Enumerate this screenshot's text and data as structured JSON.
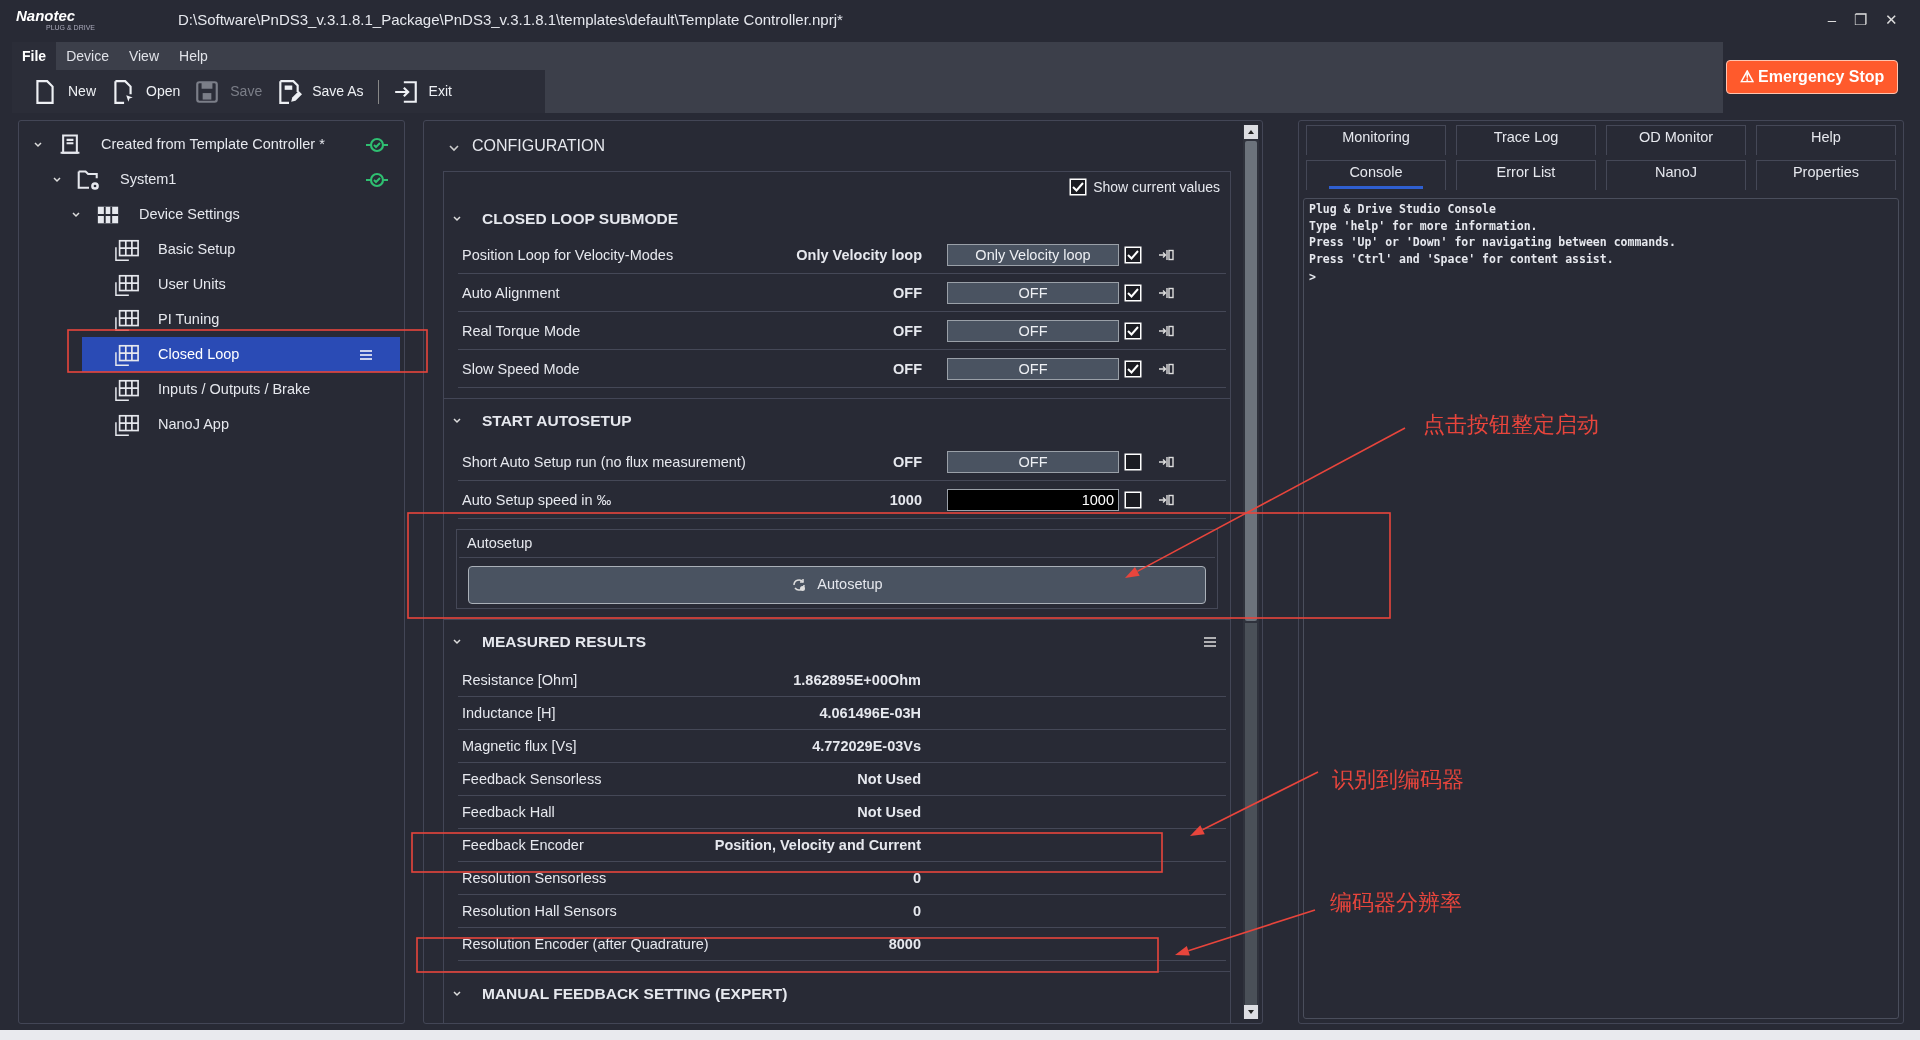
{
  "window": {
    "logo": "Nanotec",
    "logo_tagline": "PLUG & DRIVE",
    "title": "D:\\Software\\PnDS3_v.3.1.8.1_Package\\PnDS3_v.3.1.8.1\\templates\\default\\Template Controller.nprj*",
    "controls": [
      "–",
      "❐",
      "✕"
    ]
  },
  "menu": [
    {
      "label": "File",
      "selected": true
    },
    {
      "label": "Device",
      "selected": false
    },
    {
      "label": "View",
      "selected": false
    },
    {
      "label": "Help",
      "selected": false
    }
  ],
  "toolbar": [
    {
      "kind": "new",
      "label": "New",
      "disabled": false
    },
    {
      "kind": "open",
      "label": "Open",
      "disabled": false
    },
    {
      "kind": "save",
      "label": "Save",
      "disabled": true
    },
    {
      "kind": "saveas",
      "label": "Save As",
      "disabled": false
    },
    {
      "kind": "exit",
      "label": "Exit",
      "disabled": false
    }
  ],
  "emergency_stop": {
    "icon": "⚠",
    "label": "Emergency Stop"
  },
  "tree": [
    {
      "kind": "project",
      "label": "Created from Template Controller *",
      "expanded": true,
      "connected": true,
      "selected": false,
      "children": [
        {
          "kind": "system",
          "label": "System1",
          "expanded": true,
          "connected": true,
          "selected": false,
          "children": [
            {
              "kind": "settings",
              "label": "Device Settings",
              "expanded": true,
              "selected": false,
              "children": [
                {
                  "kind": "page",
                  "label": "Basic Setup",
                  "selected": false
                },
                {
                  "kind": "page",
                  "label": "User Units",
                  "selected": false
                },
                {
                  "kind": "page",
                  "label": "PI Tuning",
                  "selected": false
                },
                {
                  "kind": "page",
                  "label": "Closed Loop",
                  "selected": true
                },
                {
                  "kind": "page",
                  "label": "Inputs / Outputs / Brake",
                  "selected": false
                },
                {
                  "kind": "page",
                  "label": "NanoJ App",
                  "selected": false
                }
              ]
            }
          ]
        }
      ]
    }
  ],
  "configuration": {
    "title": "CONFIGURATION",
    "show_current_values": {
      "label": "Show current values",
      "checked": true
    },
    "sections": [
      {
        "kind": "params",
        "title": "CLOSED LOOP SUBMODE",
        "rows": [
          {
            "label": "Position Loop for Velocity-Modes",
            "current": "Only Velocity loop",
            "kind": "choice",
            "value": "Only Velocity loop",
            "checked": true
          },
          {
            "label": "Auto Alignment",
            "current": "OFF",
            "kind": "choice",
            "value": "OFF",
            "checked": true
          },
          {
            "label": "Real Torque Mode",
            "current": "OFF",
            "kind": "choice",
            "value": "OFF",
            "checked": true
          },
          {
            "label": "Slow Speed Mode",
            "current": "OFF",
            "kind": "choice",
            "value": "OFF",
            "checked": true
          }
        ]
      },
      {
        "kind": "params",
        "title": "START AUTOSETUP",
        "rows": [
          {
            "label": "Short Auto Setup run (no flux measurement)",
            "current": "OFF",
            "kind": "choice",
            "value": "OFF",
            "checked": false
          },
          {
            "label": "Auto Setup speed in ‰",
            "current": "1000",
            "kind": "number",
            "value": "1000",
            "checked": false
          }
        ],
        "group": {
          "title": "Autosetup",
          "button": "Autosetup"
        }
      },
      {
        "kind": "results",
        "title": "MEASURED RESULTS",
        "rows": [
          {
            "label": "Resistance [Ohm]",
            "current": "1.862895E+00Ohm"
          },
          {
            "label": "Inductance [H]",
            "current": "4.061496E-03H"
          },
          {
            "label": "Magnetic flux [Vs]",
            "current": "4.772029E-03Vs"
          },
          {
            "label": "Feedback Sensorless",
            "current": "Not Used"
          },
          {
            "label": "Feedback Hall",
            "current": "Not Used"
          },
          {
            "label": "Feedback Encoder",
            "current": "Position, Velocity and Current"
          },
          {
            "label": "Resolution Sensorless",
            "current": "0"
          },
          {
            "label": "Resolution Hall Sensors",
            "current": "0"
          },
          {
            "label": "Resolution Encoder (after Quadrature)",
            "current": "8000"
          }
        ]
      },
      {
        "kind": "collapsed",
        "title": "MANUAL FEEDBACK SETTING (EXPERT)"
      }
    ]
  },
  "tabs": [
    {
      "label": "Monitoring",
      "selected": false
    },
    {
      "label": "Trace Log",
      "selected": false
    },
    {
      "label": "OD Monitor",
      "selected": false
    },
    {
      "label": "Help",
      "selected": false
    },
    {
      "label": "Console",
      "selected": true
    },
    {
      "label": "Error List",
      "selected": false
    },
    {
      "label": "NanoJ",
      "selected": false
    },
    {
      "label": "Properties",
      "selected": false
    }
  ],
  "console": {
    "lines": [
      "Plug & Drive Studio Console",
      "Type 'help' for more information.",
      "Press 'Up' or 'Down' for navigating between commands.",
      "Press 'Ctrl' and 'Space' for content assist."
    ],
    "prompt": ">"
  },
  "annotations": [
    {
      "text": "点击按钮整定启动"
    },
    {
      "text": "识别到编码器"
    },
    {
      "text": "编码器分辨率"
    }
  ]
}
